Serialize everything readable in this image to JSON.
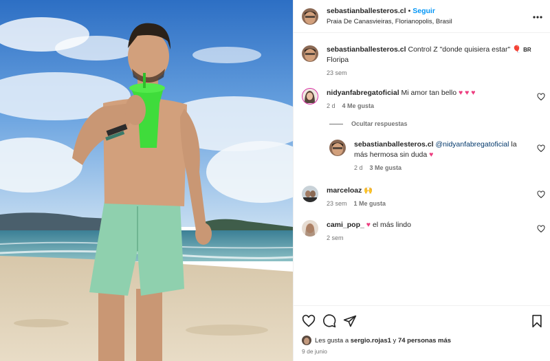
{
  "post": {
    "username": "sebastianballesteros.cl",
    "separator": "•",
    "follow_label": "Seguir",
    "location": "Praia De Canasvieiras, Florianopolis, Brasil",
    "more_label": "..."
  },
  "caption": {
    "username": "sebastianballesteros.cl",
    "text": "Control Z \"donde quisiera estar\"",
    "flag": "🎈",
    "country": "BR",
    "line2": "Floripa",
    "time": "23 sem"
  },
  "comments": [
    {
      "username": "nidyanfabregatoficial",
      "text": "Mi amor tan bello",
      "hearts": "♥ ♥ ♥",
      "time": "2 d",
      "likes": "4 Me gusta"
    },
    {
      "username": "marceloaz",
      "text": "🙌",
      "time": "23 sem",
      "likes": "1 Me gusta"
    },
    {
      "username": "cami_pop_",
      "hearts": "♥",
      "text": "el más lindo",
      "time": "2 sem"
    }
  ],
  "hide_replies_label": "Ocultar respuestas",
  "reply": {
    "username": "sebastianballesteros.cl",
    "mention": "@nidyanfabregatoficial",
    "text": "la más hermosa sin duda",
    "hearts": "♥",
    "time": "2 d",
    "likes": "3 Me gusta"
  },
  "likes_line": {
    "prefix": "Les gusta a",
    "user": "sergio.rojas1",
    "middle": "y",
    "count": "74 personas más"
  },
  "post_date": "9 de junio",
  "icons": [
    "heart-icon",
    "comment-icon",
    "share-icon",
    "bookmark-icon",
    "more-icon"
  ],
  "colors": {
    "follow": "#0095f6",
    "heart": "#ed3d7f",
    "mention": "#00376b"
  }
}
